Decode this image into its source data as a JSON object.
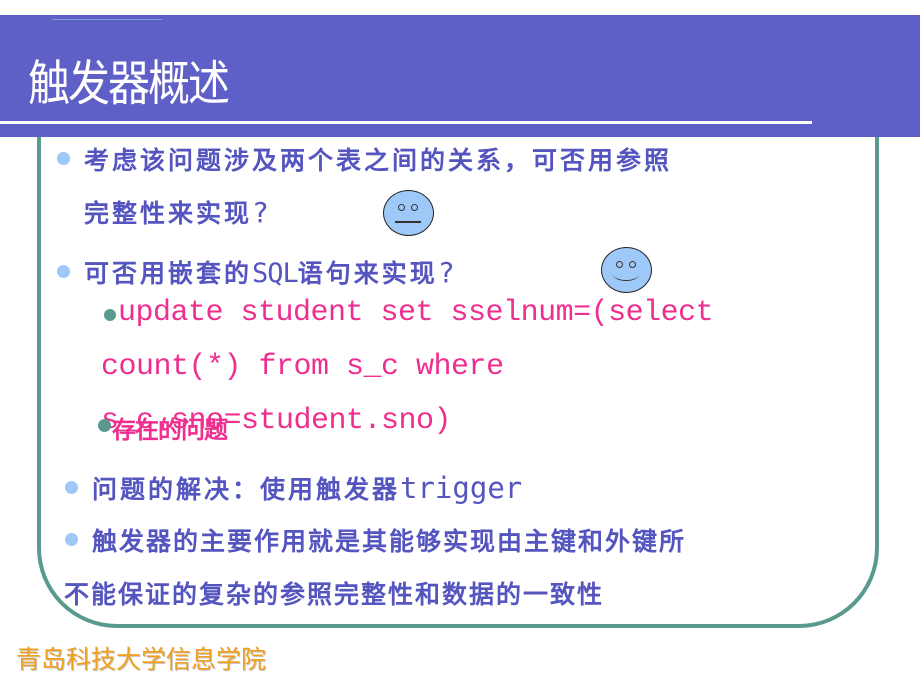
{
  "slide": {
    "title": "触发器概述",
    "bullets": [
      {
        "line1": "考虑该问题涉及两个表之间的关系，可否用参照",
        "line2_text": "完整性来实现",
        "line2_q": "?",
        "reaction_icon": "neutral-face-icon"
      },
      {
        "text_pre": "可否用嵌套的",
        "text_sql": "SQL",
        "text_post": "语句来实现",
        "text_q": "?",
        "reaction_icon": "smiley-face-icon"
      }
    ],
    "code": {
      "line1": "update student set sselnum=(select",
      "line2": "count(*) from s_c where",
      "line3": "s_c.sno=student.sno)"
    },
    "overlay_label": "存在的问题",
    "solution": {
      "text": "问题的解决：使用触发器",
      "keyword": "trigger"
    },
    "purpose": {
      "line1": "触发器的主要作用就是其能够实现由主键和外键所",
      "line2": "不能保证的复杂的参照完整性和数据的一致性"
    },
    "footer": "青岛科技大学信息学院"
  },
  "colors": {
    "header_bg": "#5f5fc8",
    "body_text": "#5555c0",
    "code_text": "#ee2f8f",
    "border": "#5a9a8e",
    "bullet": "#9ec8f8",
    "footer_text": "#f0a020"
  }
}
